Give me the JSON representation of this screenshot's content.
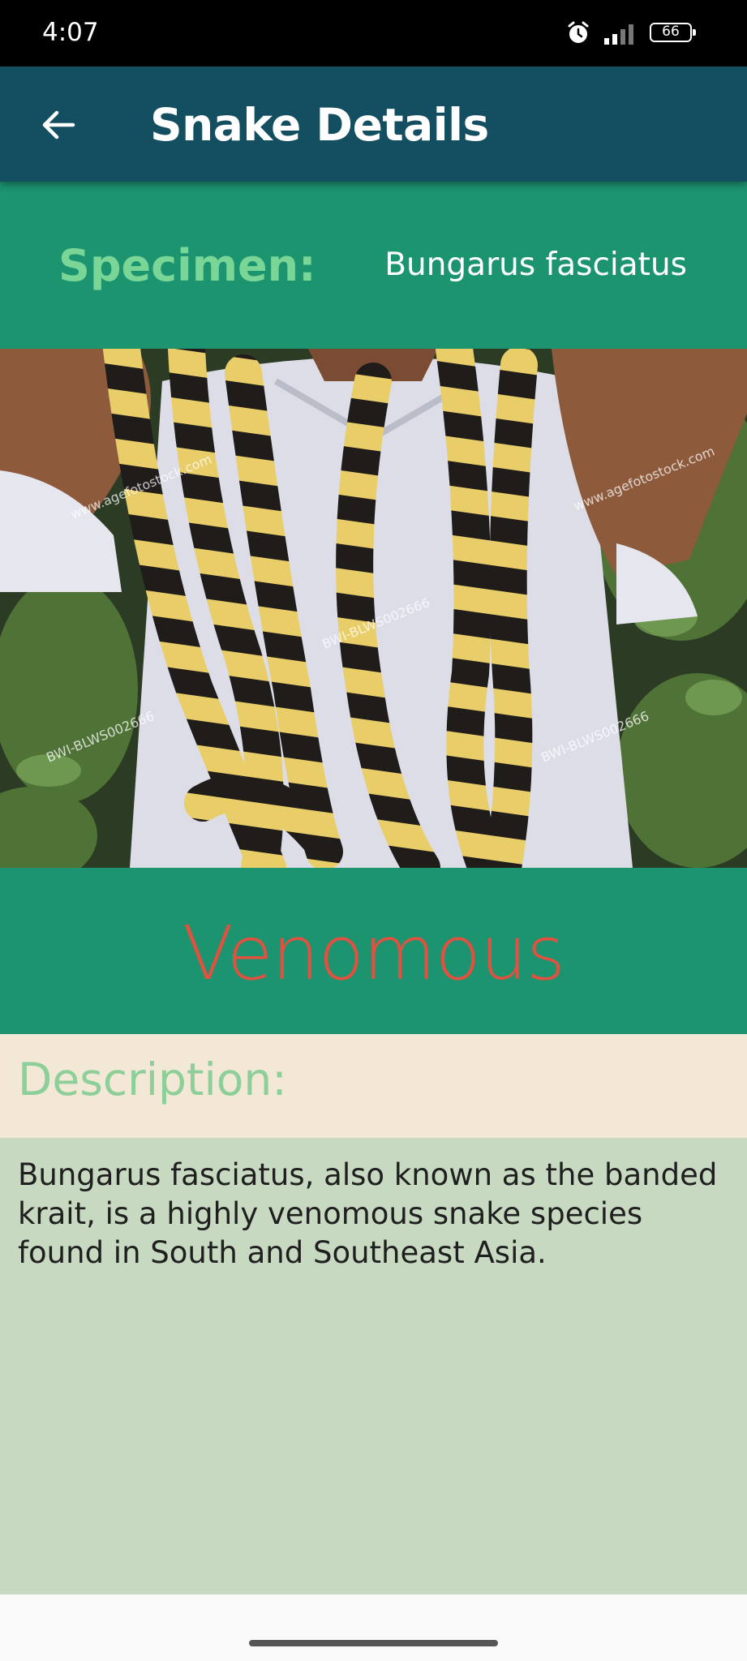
{
  "status_bar": {
    "time": "4:07",
    "battery": "66"
  },
  "app_bar": {
    "title": "Snake Details",
    "background_color": "#134e61"
  },
  "specimen": {
    "label": "Specimen:",
    "value": "Bungarus fasciatus"
  },
  "photo": {
    "watermarks": [
      "www.agefotostock.com",
      "BWI-BLWS002666"
    ]
  },
  "venom_status": {
    "text": "Venomous",
    "color": "#e2513f"
  },
  "description": {
    "label": "Description:",
    "text": "Bungarus fasciatus, also known as the banded krait, is a highly venomous snake species found in South and Southeast Asia."
  },
  "colors": {
    "green_panel": "#1c9470",
    "label_green": "#79d697",
    "description_header_bg": "#f3e8d6",
    "description_body_bg": "#c7d9c0"
  }
}
